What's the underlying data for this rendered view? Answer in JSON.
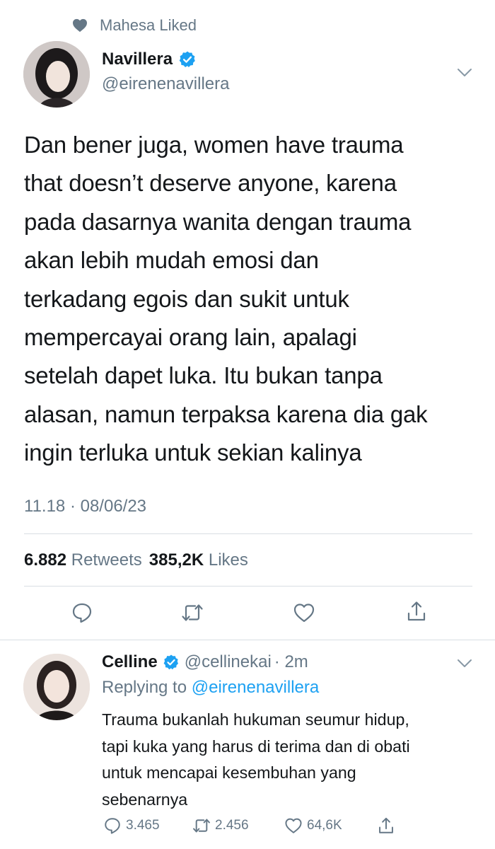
{
  "context": {
    "text": "Mahesa Liked",
    "icon": "heart-filled-icon"
  },
  "tweet": {
    "name": "Navillera",
    "handle": "@eirenenavillera",
    "lines": [
      "Dan bener juga, women have trauma",
      "that doesn’t deserve anyone, karena",
      "pada dasarnya wanita dengan trauma",
      "akan lebih mudah emosi dan",
      "terkadang egois dan sukit untuk",
      "mempercayai orang lain, apalagi",
      "setelah dapet luka. Itu bukan tanpa",
      "alasan, namun terpaksa karena dia gak",
      "ingin terluka untuk sekian kalinya"
    ],
    "timestamp": "11.18 · 08/06/23",
    "retweets_count": "6.882",
    "retweets_label": "Retweets",
    "likes_count": "385,2K",
    "likes_label": "Likes"
  },
  "reply": {
    "name": "Celline",
    "handle": "@cellinekai",
    "time": "· 2m",
    "replying_prefix": "Replying to",
    "replying_handle": "@eirenenavillera",
    "lines": [
      "Trauma bukanlah hukuman seumur hidup,",
      "tapi kuka yang harus di terima dan di obati",
      "untuk mencapai kesembuhan yang",
      "sebenarnya"
    ],
    "replies": "3.465",
    "retweets": "2.456",
    "likes": "64,6K"
  },
  "colors": {
    "accent": "#1da1f2",
    "muted": "#657786",
    "text": "#14171a",
    "divider": "#d8dee3"
  }
}
